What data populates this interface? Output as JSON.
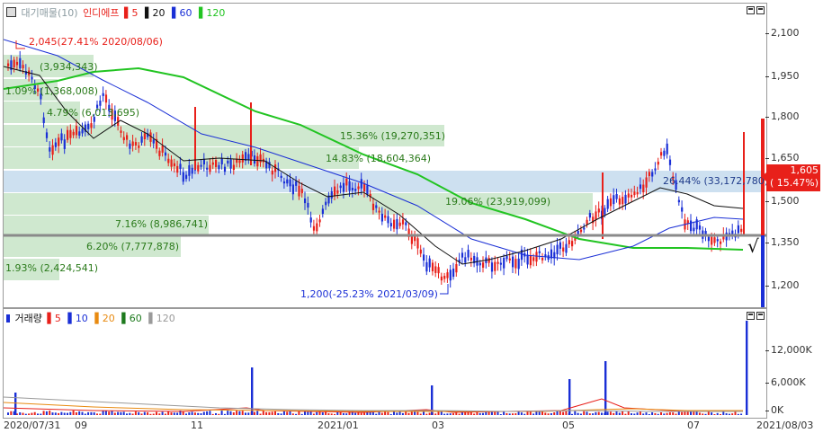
{
  "price_panel": {
    "legend": {
      "title": "대기매물(10)",
      "name": "인디에프",
      "ma": [
        {
          "label": "5",
          "color": "#e8201a"
        },
        {
          "label": "20",
          "color": "#111111"
        },
        {
          "label": "60",
          "color": "#1a2fd6"
        },
        {
          "label": "120",
          "color": "#22c422"
        }
      ]
    },
    "y_ticks": [
      "2,100",
      "1,950",
      "1,800",
      "1,650",
      "1,500",
      "1,350",
      "1,200"
    ],
    "current_price": "1,605",
    "current_change": "( 15.47%)",
    "high_note": "2,045(27.41% 2020/08/06)",
    "low_note": "1,200(-25.23% 2021/03/09)",
    "volume_profile": [
      {
        "label": "(3,934,343)",
        "color": "#2a7a1a"
      },
      {
        "label": "1.09% (1,368,008)",
        "color": "#2a7a1a"
      },
      {
        "label": "4.79% (6,013,695)",
        "color": "#2a7a1a"
      },
      {
        "label": "15.36% (19,270,351)",
        "color": "#2a7a1a"
      },
      {
        "label": "14.83% (18,604,364)",
        "color": "#2a7a1a"
      },
      {
        "label": "26.44% (33,172,780)",
        "color": "#1f3b8a"
      },
      {
        "label": "19.06% (23,919,099)",
        "color": "#2a7a1a"
      },
      {
        "label": "7.16% (8,986,741)",
        "color": "#2a7a1a"
      },
      {
        "label": "6.20% (7,777,878)",
        "color": "#2a7a1a"
      },
      {
        "label": "1.93% (2,424,541)",
        "color": "#2a7a1a"
      }
    ],
    "check_glyph": "√"
  },
  "volume_panel": {
    "legend": {
      "title": "거래량",
      "ma": [
        {
          "label": "5",
          "color": "#e8201a"
        },
        {
          "label": "10",
          "color": "#1a2fd6"
        },
        {
          "label": "20",
          "color": "#e88a10"
        },
        {
          "label": "60",
          "color": "#1e7a1e"
        },
        {
          "label": "120",
          "color": "#9a9a9a"
        }
      ]
    },
    "y_ticks": [
      "12,000K",
      "6,000K",
      "0K"
    ]
  },
  "x_axis": {
    "labels": [
      "2020/07/31",
      "09",
      "11",
      "2021/01",
      "03",
      "05",
      "07",
      "2021/08/03"
    ]
  },
  "colors": {
    "up": "#e8201a",
    "down": "#1a2fd6",
    "vp_green": "#cfe8cf",
    "vp_blue": "#cde0f0"
  }
}
